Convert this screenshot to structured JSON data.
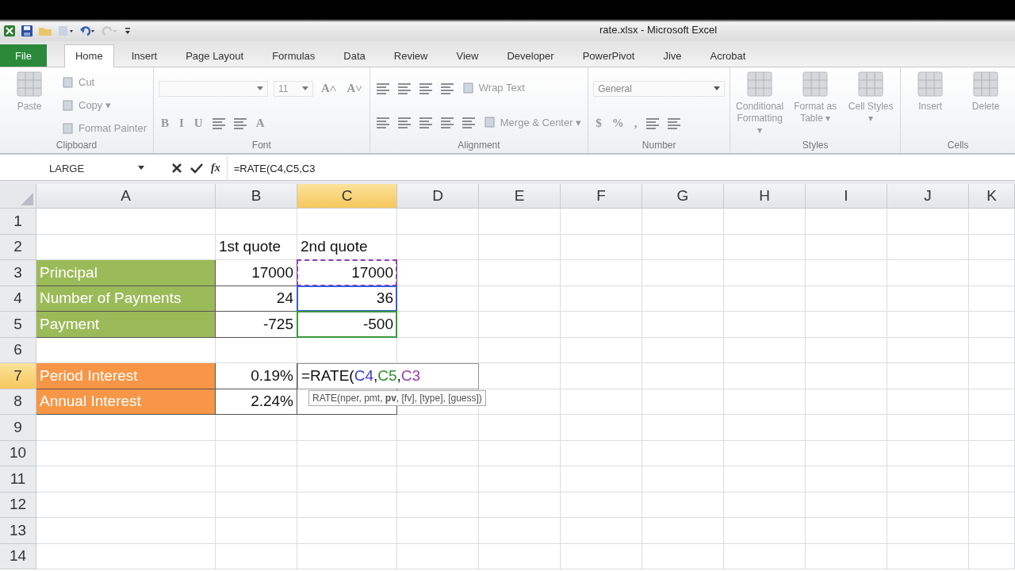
{
  "window": {
    "title": "rate.xlsx - Microsoft Excel"
  },
  "tabs": [
    {
      "label": "File",
      "kind": "file",
      "selected": false
    },
    {
      "label": "Home",
      "kind": "tab",
      "selected": true
    },
    {
      "label": "Insert",
      "kind": "tab",
      "selected": false
    },
    {
      "label": "Page Layout",
      "kind": "tab",
      "selected": false
    },
    {
      "label": "Formulas",
      "kind": "tab",
      "selected": false
    },
    {
      "label": "Data",
      "kind": "tab",
      "selected": false
    },
    {
      "label": "Review",
      "kind": "tab",
      "selected": false
    },
    {
      "label": "View",
      "kind": "tab",
      "selected": false
    },
    {
      "label": "Developer",
      "kind": "tab",
      "selected": false
    },
    {
      "label": "PowerPivot",
      "kind": "tab",
      "selected": false
    },
    {
      "label": "Jive",
      "kind": "tab",
      "selected": false
    },
    {
      "label": "Acrobat",
      "kind": "tab",
      "selected": false
    }
  ],
  "ribbon": [
    {
      "name": "Clipboard",
      "large": [
        {
          "label": "Paste"
        }
      ],
      "rows": [
        [
          {
            "kind": "small",
            "label": "Cut"
          }
        ],
        [
          {
            "kind": "small",
            "label": "Copy ▾"
          }
        ],
        [
          {
            "kind": "small",
            "label": "Format Painter"
          }
        ]
      ]
    },
    {
      "name": "Font",
      "rows": [
        [
          {
            "kind": "font-box"
          },
          {
            "kind": "size-box",
            "label": "11"
          },
          {
            "kind": "glyph",
            "label": "A˄"
          },
          {
            "kind": "glyph",
            "label": "A˅"
          }
        ],
        [
          {
            "kind": "glyph",
            "label": "B"
          },
          {
            "kind": "glyph",
            "label": "I"
          },
          {
            "kind": "glyph",
            "label": "U"
          },
          {
            "kind": "icon"
          },
          {
            "kind": "icon"
          },
          {
            "kind": "glyph",
            "label": "A"
          }
        ]
      ]
    },
    {
      "name": "Alignment",
      "rows": [
        [
          {
            "kind": "icon"
          },
          {
            "kind": "icon"
          },
          {
            "kind": "icon"
          },
          {
            "kind": "icon"
          },
          {
            "kind": "small",
            "label": "Wrap Text"
          }
        ],
        [
          {
            "kind": "icon"
          },
          {
            "kind": "icon"
          },
          {
            "kind": "icon"
          },
          {
            "kind": "icon"
          },
          {
            "kind": "icon"
          },
          {
            "kind": "small",
            "label": "Merge & Center ▾"
          }
        ]
      ]
    },
    {
      "name": "Number",
      "rows": [
        [
          {
            "kind": "format-box",
            "label": "General"
          }
        ],
        [
          {
            "kind": "glyph",
            "label": "$"
          },
          {
            "kind": "glyph",
            "label": "%"
          },
          {
            "kind": "glyph",
            "label": ","
          },
          {
            "kind": "icon"
          },
          {
            "kind": "icon"
          }
        ]
      ]
    },
    {
      "name": "Styles",
      "large": [
        {
          "label": "Conditional Formatting ▾"
        },
        {
          "label": "Format as Table ▾"
        },
        {
          "label": "Cell Styles ▾"
        }
      ]
    },
    {
      "name": "Cells",
      "large": [
        {
          "label": "Insert"
        },
        {
          "label": "Delete"
        }
      ]
    }
  ],
  "formula_bar": {
    "name_box": "LARGE",
    "function_button": "fx",
    "formula": "=RATE(C4,C5,C3"
  },
  "columns": [
    {
      "label": "A",
      "selected": false
    },
    {
      "label": "B",
      "selected": false
    },
    {
      "label": "C",
      "selected": true
    },
    {
      "label": "D",
      "selected": false
    },
    {
      "label": "E",
      "selected": false
    },
    {
      "label": "F",
      "selected": false
    },
    {
      "label": "G",
      "selected": false
    },
    {
      "label": "H",
      "selected": false
    },
    {
      "label": "I",
      "selected": false
    },
    {
      "label": "J",
      "selected": false
    },
    {
      "label": "K",
      "selected": false
    }
  ],
  "rows": [
    {
      "number": "1",
      "selected": false
    },
    {
      "number": "2",
      "selected": false,
      "quote_1": {
        "text": "1st quote",
        "kind": "text"
      },
      "quote_2": {
        "text": "2nd quote",
        "kind": "text"
      }
    },
    {
      "number": "3",
      "selected": false,
      "label": {
        "text": "Principal",
        "color": "#9bbb59"
      },
      "quote_1": {
        "text": "17000",
        "kind": "number"
      },
      "quote_2": {
        "text": "17000",
        "kind": "number",
        "reference": {
          "color": "#8e3fb0",
          "kind": "dashed"
        }
      }
    },
    {
      "number": "4",
      "selected": false,
      "label": {
        "text": "Number of Payments",
        "color": "#9bbb59"
      },
      "quote_1": {
        "text": "24",
        "kind": "number"
      },
      "quote_2": {
        "text": "36",
        "kind": "number",
        "reference": {
          "color": "#3b5bdb",
          "kind": "solid"
        }
      }
    },
    {
      "number": "5",
      "selected": false,
      "label": {
        "text": "Payment",
        "color": "#9bbb59"
      },
      "quote_1": {
        "text": "-725",
        "kind": "number"
      },
      "quote_2": {
        "text": "-500",
        "kind": "number",
        "reference": {
          "color": "#3a9a3a",
          "kind": "solid"
        }
      }
    },
    {
      "number": "6",
      "selected": false
    },
    {
      "number": "7",
      "selected": true,
      "label": {
        "text": "Period Interest",
        "color": "#f79646"
      },
      "quote_1": {
        "text": "0.19%",
        "kind": "number"
      },
      "quote_2": {
        "kind": "formula",
        "parts": [
          {
            "text": "=RATE("
          },
          {
            "text": "C4",
            "color": "#3b3bc8"
          },
          {
            "text": ","
          },
          {
            "text": "C5",
            "color": "#2f8f2f"
          },
          {
            "text": ","
          },
          {
            "text": "C3",
            "color": "#9a3ab0"
          }
        ]
      }
    },
    {
      "number": "8",
      "selected": false,
      "label": {
        "text": "Annual Interest",
        "color": "#f79646"
      },
      "quote_1": {
        "text": "2.24%",
        "kind": "number"
      },
      "tooltip": "RATE(nper, pmt, **pv**, [fv], [type], [guess])"
    },
    {
      "number": "9",
      "selected": false
    },
    {
      "number": "10",
      "selected": false
    },
    {
      "number": "11",
      "selected": false
    },
    {
      "number": "12",
      "selected": false
    },
    {
      "number": "13",
      "selected": false
    },
    {
      "number": "14",
      "selected": false
    }
  ]
}
